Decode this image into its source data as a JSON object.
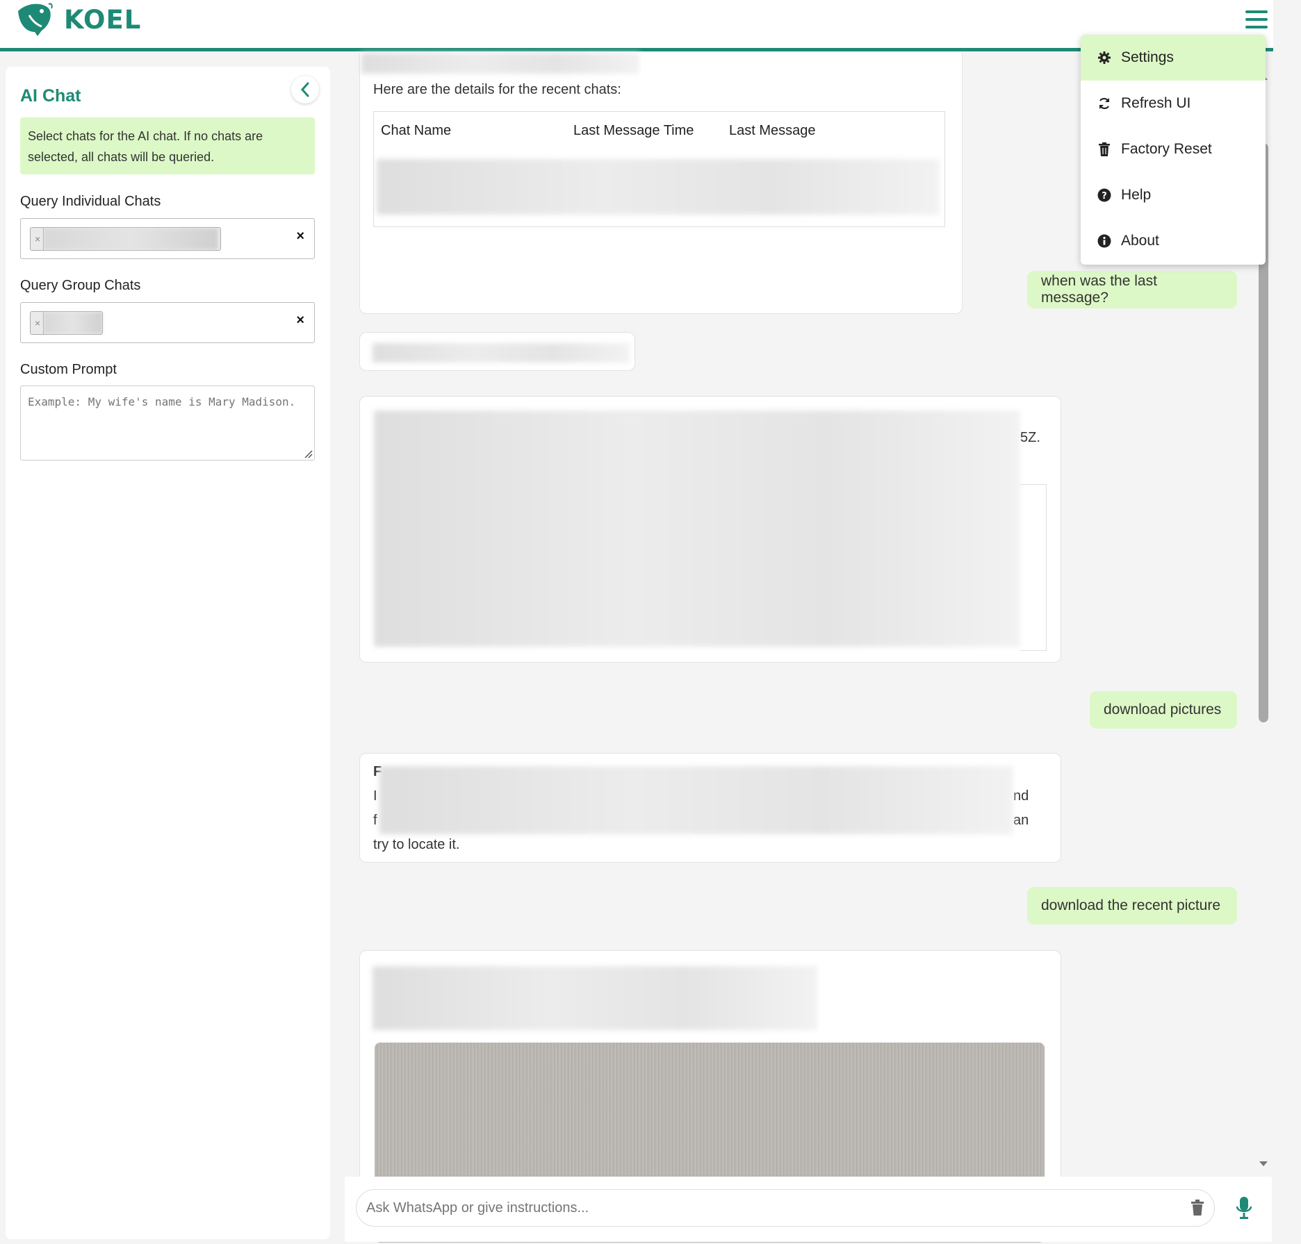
{
  "app": {
    "brand": "KOEL",
    "accent_color": "#1e8a75",
    "bubble_color": "#dcf8c6"
  },
  "sidebar": {
    "title": "AI Chat",
    "info": "Select chats for the AI chat. If no chats are selected, all chats will be queried.",
    "individual_label": "Query Individual Chats",
    "group_label": "Query Group Chats",
    "prompt_label": "Custom Prompt",
    "prompt_placeholder": "Example: My wife's name is Mary Madison.",
    "chip_remove_glyph": "×",
    "clear_glyph": "×"
  },
  "menu": {
    "items": [
      {
        "label": "Settings",
        "icon": "gear-icon"
      },
      {
        "label": "Refresh UI",
        "icon": "refresh-icon"
      },
      {
        "label": "Factory Reset",
        "icon": "trash-icon"
      },
      {
        "label": "Help",
        "icon": "question-icon"
      },
      {
        "label": "About",
        "icon": "info-icon"
      }
    ]
  },
  "chat": {
    "msg1_intro": "Here are the details for the recent chats:",
    "table_headers": [
      "Chat Name",
      "Last Message Time",
      "Last Message"
    ],
    "user1": "when was the last message?",
    "msg3_fragment": "5Z.",
    "user2": "download pictures",
    "msg4_frag_left": [
      "F",
      "I",
      "f"
    ],
    "msg4_frag_right": [
      "nd",
      "an"
    ],
    "msg4_last_line": "try to locate it.",
    "user3": "download the recent picture"
  },
  "input": {
    "placeholder": "Ask WhatsApp or give instructions..."
  }
}
